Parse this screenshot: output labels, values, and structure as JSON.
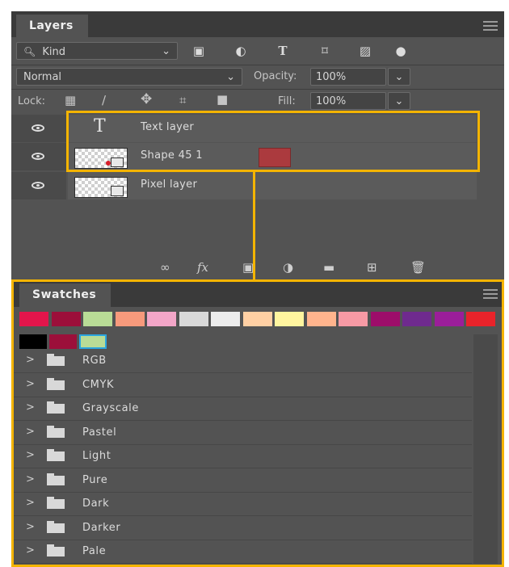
{
  "layers_panel": {
    "tab_label": "Layers",
    "filter": {
      "kind_label": "Kind"
    },
    "blend_mode": "Normal",
    "opacity_label": "Opacity:",
    "opacity_value": "100%",
    "lock_label": "Lock:",
    "fill_label": "Fill:",
    "fill_value": "100%",
    "layers": [
      {
        "name": "Text layer",
        "kind": "text"
      },
      {
        "name": "Shape 45 1",
        "kind": "shape",
        "color": "#ab3a3e"
      },
      {
        "name": "Pixel layer",
        "kind": "pixel"
      }
    ],
    "bottom_fx": "fx"
  },
  "swatches_panel": {
    "tab_label": "Swatches",
    "recent_colors": [
      "#e3154b",
      "#9c0f3a",
      "#b9dc96",
      "#f79a7c",
      "#f3a6c8",
      "#d9d9d9",
      "#ececec",
      "#ffd0a4",
      "#fff59f",
      "#ffb48d",
      "#f79aa5",
      "#9d0d6a",
      "#6f2a8e",
      "#9b1e9a",
      "#e9232a"
    ],
    "row2_colors": [
      "#000000",
      "#9c0f3a",
      "#b9dc96"
    ],
    "groups": [
      "RGB",
      "CMYK",
      "Grayscale",
      "Pastel",
      "Light",
      "Pure",
      "Dark",
      "Darker",
      "Pale"
    ]
  },
  "accent_color": "#f4b400"
}
